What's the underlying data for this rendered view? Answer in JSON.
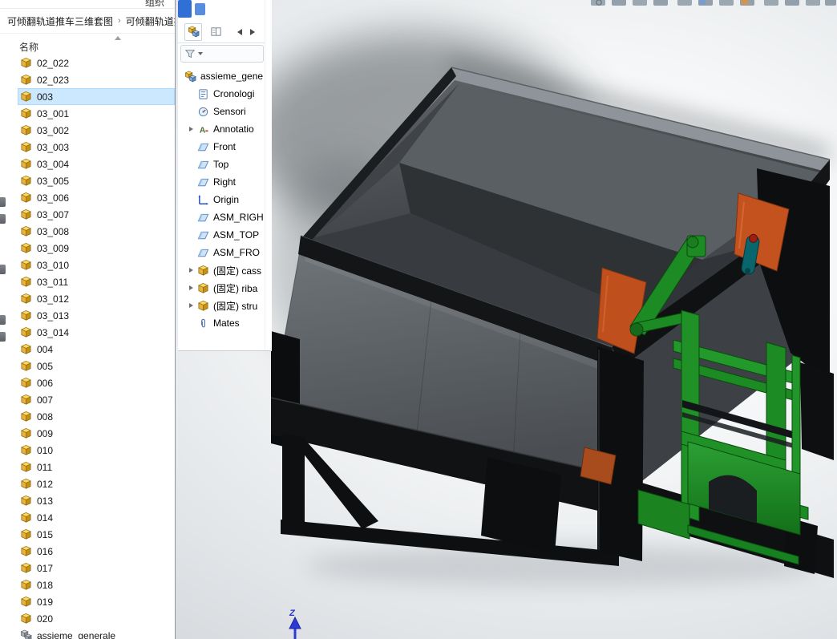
{
  "file_dialog": {
    "toolbar": {
      "organize_label": "组织"
    },
    "breadcrumb": {
      "segments": [
        "可倾翻轨道推车三维套图",
        "可倾翻轨道推"
      ],
      "separator": "›"
    },
    "columns": {
      "name_header": "名称"
    },
    "selected_item": "003",
    "items": [
      "02_022",
      "02_023",
      "003",
      "03_001",
      "03_002",
      "03_003",
      "03_004",
      "03_005",
      "03_006",
      "03_007",
      "03_008",
      "03_009",
      "03_010",
      "03_011",
      "03_012",
      "03_013",
      "03_014",
      "004",
      "005",
      "006",
      "007",
      "008",
      "009",
      "010",
      "011",
      "012",
      "013",
      "014",
      "015",
      "016",
      "017",
      "018",
      "019",
      "020",
      "assieme_generale"
    ]
  },
  "feature_tree": {
    "root_label": "assieme_gene",
    "items": [
      {
        "label": "Cronologi",
        "icon": "history-icon"
      },
      {
        "label": "Sensori",
        "icon": "sensors-icon"
      },
      {
        "label": "Annotatio",
        "icon": "annotations-icon",
        "expandable": true
      },
      {
        "label": "Front",
        "icon": "plane-icon"
      },
      {
        "label": "Top",
        "icon": "plane-icon"
      },
      {
        "label": "Right",
        "icon": "plane-icon"
      },
      {
        "label": "Origin",
        "icon": "origin-icon"
      },
      {
        "label": "ASM_RIGH",
        "icon": "plane-icon"
      },
      {
        "label": "ASM_TOP",
        "icon": "plane-icon"
      },
      {
        "label": "ASM_FRO",
        "icon": "plane-icon"
      },
      {
        "label": "(固定) cass",
        "icon": "part-icon",
        "expandable": true
      },
      {
        "label": "(固定) riba",
        "icon": "part-icon",
        "expandable": true
      },
      {
        "label": "(固定) stru",
        "icon": "part-icon",
        "expandable": true
      },
      {
        "label": "Mates",
        "icon": "mates-icon"
      }
    ]
  },
  "viewport": {
    "triad": {
      "axis_label": "Z"
    },
    "model_colors": {
      "hopper_gray": "#46494d",
      "frame_black": "#101214",
      "wedge_orange": "#c4521f",
      "mechanism_green": "#1f9226",
      "cylinder_teal": "#0a666d"
    }
  }
}
